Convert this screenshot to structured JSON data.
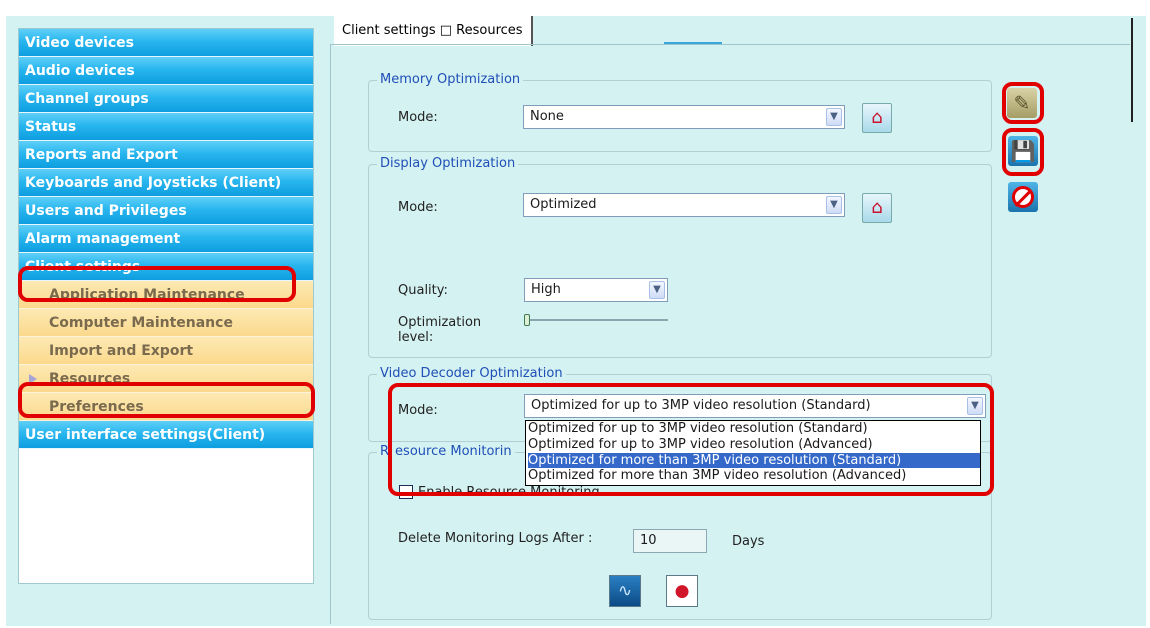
{
  "sidebar": {
    "items": [
      {
        "label": "Video devices",
        "type": "main"
      },
      {
        "label": "Audio devices",
        "type": "main"
      },
      {
        "label": "Channel groups",
        "type": "main"
      },
      {
        "label": "Status",
        "type": "main"
      },
      {
        "label": "Reports and Export",
        "type": "main"
      },
      {
        "label": "Keyboards and Joysticks (Client)",
        "type": "main"
      },
      {
        "label": "Users and Privileges",
        "type": "main"
      },
      {
        "label": "Alarm management",
        "type": "main"
      },
      {
        "label": "Client settings",
        "type": "main",
        "expanded": true
      },
      {
        "label": "Application Maintenance",
        "type": "sub"
      },
      {
        "label": "Computer Maintenance",
        "type": "sub"
      },
      {
        "label": "Import and Export",
        "type": "sub"
      },
      {
        "label": "Resources",
        "type": "sub",
        "selected": true
      },
      {
        "label": "Preferences",
        "type": "sub"
      },
      {
        "label": "User interface settings(Client)",
        "type": "main"
      }
    ]
  },
  "tab": {
    "label": "Client settings □ Resources"
  },
  "memory": {
    "legend": "Memory Optimization",
    "mode_label": "Mode:",
    "mode_value": "None"
  },
  "display": {
    "legend": "Display Optimization",
    "mode_label": "Mode:",
    "mode_value": "Optimized",
    "quality_label": "Quality:",
    "quality_value": "High",
    "level_label_1": "Optimization",
    "level_label_2": "level:",
    "level_fraction": 0.0
  },
  "decoder": {
    "legend": "Video Decoder Optimization",
    "mode_label": "Mode:",
    "mode_value": "Optimized for up to 3MP video resolution (Standard)",
    "options": [
      "Optimized for up to 3MP video resolution (Standard)",
      "Optimized for up to 3MP video resolution (Advanced)",
      "Optimized for more than 3MP video resolution (Standard)",
      "Optimized for more than 3MP video resolution (Advanced)"
    ],
    "highlighted_option_index": 2
  },
  "monitoring": {
    "legend": "Resource Monitoring",
    "legend_visible_left": "R",
    "legend_visible_right": "esource Monitorin",
    "enable_label_left": "Enable Resource Monitoring",
    "enable_checked": false,
    "delete_label": "Delete Monitoring Logs After :",
    "delete_value": "10",
    "days_label": "Days"
  },
  "icons": {
    "house": "house-icon",
    "edit": "pencil-icon",
    "save": "floppy-disk-icon",
    "cancel": "no-entry-icon",
    "monitor": "heartbeat-monitor-icon",
    "report": "report-chart-icon"
  },
  "colors": {
    "nav_main": "#29b6ef",
    "nav_sub": "#fbd98c",
    "background": "#d5f2f2",
    "legend": "#1f4fb7",
    "highlight_ring": "#e10000",
    "list_selection": "#3569c9"
  }
}
